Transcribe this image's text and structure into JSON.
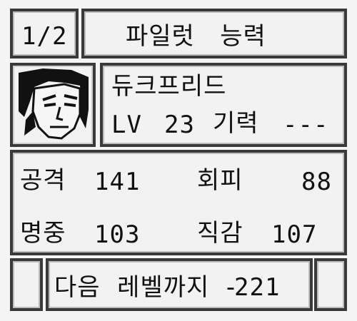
{
  "header": {
    "page_indicator": "1/2",
    "title": "파일럿   능력"
  },
  "pilot": {
    "portrait_icon": "pilot-portrait-icon",
    "name": "듀크프리드",
    "level_label": "LV",
    "level": "23",
    "spirit_label": "기력",
    "spirit": "---"
  },
  "stats": {
    "attack_label": "공격",
    "attack": "141",
    "evasion_label": "회피",
    "evasion": "88",
    "accuracy_label": "명중",
    "accuracy": "103",
    "intuition_label": "직감",
    "intuition": "107"
  },
  "footer": {
    "next_level_label": "다음  레벨까지  -",
    "next_level_exp": "221"
  }
}
